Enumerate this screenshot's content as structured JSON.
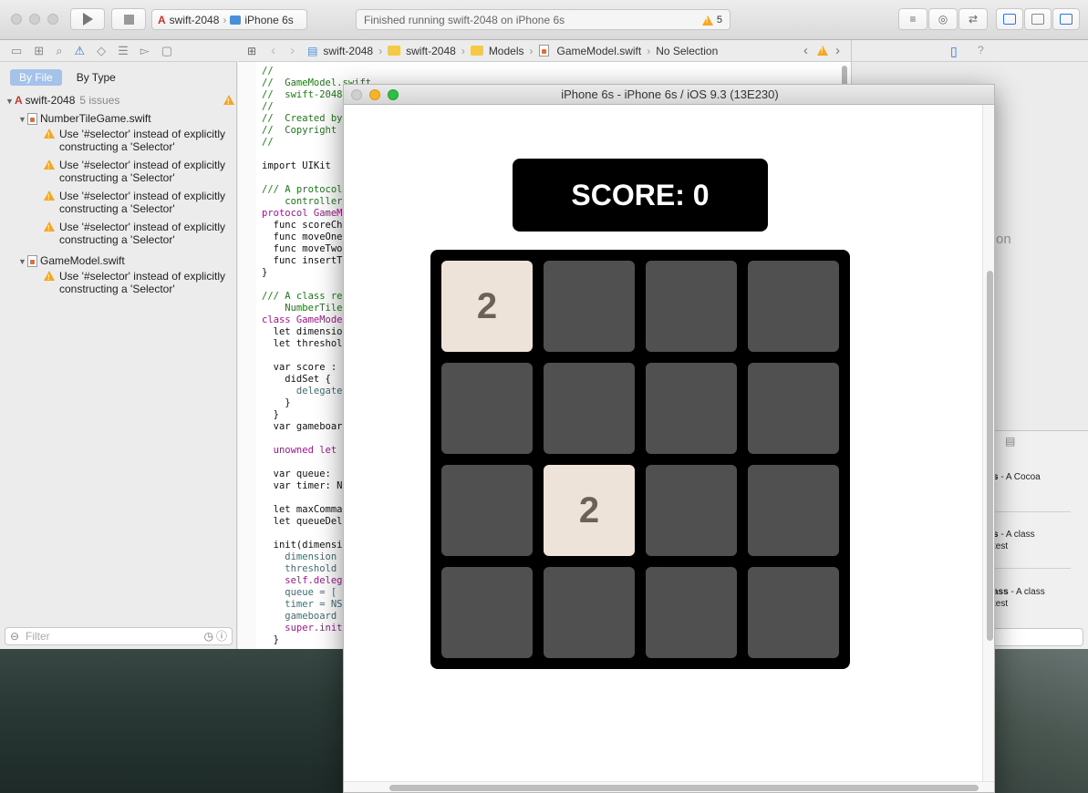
{
  "toolbar": {
    "scheme_project": "swift-2048",
    "scheme_device": "iPhone 6s",
    "status_text": "Finished running swift-2048 on iPhone 6s",
    "warning_count": "5"
  },
  "navigator": {
    "by_file": "By File",
    "by_type": "By Type",
    "project": "swift-2048",
    "issue_count": "5 issues",
    "files": [
      {
        "name": "NumberTileGame.swift",
        "issues": [
          "Use '#selector' instead of explicitly constructing a 'Selector'",
          "Use '#selector' instead of explicitly constructing a 'Selector'",
          "Use '#selector' instead of explicitly constructing a 'Selector'",
          "Use '#selector' instead of explicitly constructing a 'Selector'"
        ]
      },
      {
        "name": "GameModel.swift",
        "issues": [
          "Use '#selector' instead of explicitly constructing a 'Selector'"
        ]
      }
    ],
    "filter_placeholder": "Filter"
  },
  "jumpbar": {
    "project": "swift-2048",
    "group": "swift-2048",
    "folder": "Models",
    "file": "GameModel.swift",
    "selection": "No Selection"
  },
  "editor": {
    "lines": [
      {
        "text": "//",
        "cls": "c"
      },
      {
        "text": "//  GameModel.swift",
        "cls": "c"
      },
      {
        "text": "//  swift-2048",
        "cls": "c"
      },
      {
        "text": "//",
        "cls": "c"
      },
      {
        "text": "//  Created by",
        "cls": "c"
      },
      {
        "text": "//  Copyright",
        "cls": "c"
      },
      {
        "text": "//",
        "cls": "c"
      },
      {
        "text": "",
        "cls": ""
      },
      {
        "text": "import UIKit",
        "cls": ""
      },
      {
        "text": "",
        "cls": ""
      },
      {
        "text": "/// A protocol",
        "cls": "c"
      },
      {
        "text": "    controller",
        "cls": "c"
      },
      {
        "text": "protocol GameM",
        "cls": "k"
      },
      {
        "text": "  func scoreCh",
        "cls": ""
      },
      {
        "text": "  func moveOne",
        "cls": ""
      },
      {
        "text": "  func moveTwo",
        "cls": ""
      },
      {
        "text": "  func insertT",
        "cls": ""
      },
      {
        "text": "}",
        "cls": ""
      },
      {
        "text": "",
        "cls": ""
      },
      {
        "text": "/// A class re",
        "cls": "c"
      },
      {
        "text": "    NumberTile",
        "cls": "c"
      },
      {
        "text": "class GameMode",
        "cls": "k"
      },
      {
        "text": "  let dimensio",
        "cls": ""
      },
      {
        "text": "  let threshol",
        "cls": ""
      },
      {
        "text": "",
        "cls": ""
      },
      {
        "text": "  var score :",
        "cls": ""
      },
      {
        "text": "    didSet {",
        "cls": ""
      },
      {
        "text": "      delegate",
        "cls": "t"
      },
      {
        "text": "    }",
        "cls": ""
      },
      {
        "text": "  }",
        "cls": ""
      },
      {
        "text": "  var gameboar",
        "cls": ""
      },
      {
        "text": "",
        "cls": ""
      },
      {
        "text": "  unowned let",
        "cls": "k"
      },
      {
        "text": "",
        "cls": ""
      },
      {
        "text": "  var queue:",
        "cls": ""
      },
      {
        "text": "  var timer: N",
        "cls": ""
      },
      {
        "text": "",
        "cls": ""
      },
      {
        "text": "  let maxComma",
        "cls": ""
      },
      {
        "text": "  let queueDel",
        "cls": ""
      },
      {
        "text": "",
        "cls": ""
      },
      {
        "text": "  init(dimensi",
        "cls": ""
      },
      {
        "text": "    dimension",
        "cls": "t"
      },
      {
        "text": "    threshold",
        "cls": "t"
      },
      {
        "text": "    self.deleg",
        "cls": "k"
      },
      {
        "text": "    queue = [",
        "cls": "t"
      },
      {
        "text": "    timer = NS",
        "cls": "t"
      },
      {
        "text": "    gameboard",
        "cls": "t"
      },
      {
        "text": "    super.init",
        "cls": "k"
      },
      {
        "text": "  }",
        "cls": ""
      }
    ]
  },
  "inspector": {
    "partial_text": "on",
    "library": [
      {
        "lead": "s",
        "rest": " - A Cocoa"
      },
      {
        "lead": "s",
        "rest": " - A class",
        "sub": "test"
      },
      {
        "lead": "ass",
        "rest": " - A class",
        "sub": "test"
      }
    ]
  },
  "simulator": {
    "title": "iPhone 6s - iPhone 6s / iOS 9.3 (13E230)",
    "score_label": "SCORE: 0",
    "board": [
      [
        "2",
        "",
        "",
        ""
      ],
      [
        "",
        "",
        "",
        ""
      ],
      [
        "",
        "2",
        "",
        ""
      ],
      [
        "",
        "",
        "",
        ""
      ]
    ],
    "colors": {
      "empty_tile": "#505050",
      "filled_tile": "#eee3d9",
      "tile_text": "#6d6055",
      "board": "#000000"
    }
  }
}
